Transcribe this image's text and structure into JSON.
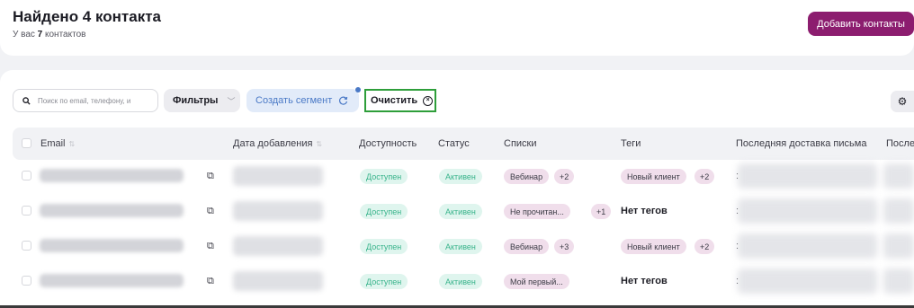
{
  "header": {
    "title": "Найдено 4 контакта",
    "subtitle_prefix": "У вас ",
    "subtitle_count": "7",
    "subtitle_suffix": " контактов",
    "add_button": "Добавить контакты"
  },
  "toolbar": {
    "search_placeholder": "Поиск по email, телефону, и",
    "filters_label": "Фильтры",
    "segment_label": "Создать сегмент",
    "clear_label": "Очистить"
  },
  "table": {
    "columns": [
      "Email",
      "Дата добавления",
      "Доступность",
      "Статус",
      "Списки",
      "Теги",
      "Последняя доставка письма",
      "После"
    ],
    "rows": [
      {
        "availability": "Доступен",
        "status": "Активен",
        "list": "Вебинар",
        "list_more": "+2",
        "tag": "Новый клиент",
        "tag_more": "+2",
        "no_tags": ""
      },
      {
        "availability": "Доступен",
        "status": "Активен",
        "list": "Не прочитан...",
        "list_more": "+1",
        "tag": "",
        "tag_more": "",
        "no_tags": "Нет тегов"
      },
      {
        "availability": "Доступен",
        "status": "Активен",
        "list": "Вебинар",
        "list_more": "+3",
        "tag": "Новый клиент",
        "tag_more": "+2",
        "no_tags": ""
      },
      {
        "availability": "Доступен",
        "status": "Активен",
        "list": "Мой первый...",
        "list_more": "",
        "tag": "",
        "tag_more": "",
        "no_tags": "Нет тегов"
      }
    ]
  },
  "colors": {
    "accent": "#8c1d6f",
    "highlight_border": "#2e9e3a",
    "available": "#37b38a",
    "segment": "#4a79c6"
  },
  "icons": [
    "search-icon",
    "chevron-down-icon",
    "refresh-icon",
    "close-circle-icon",
    "gear-icon",
    "external-link-icon",
    "sort-icon"
  ]
}
